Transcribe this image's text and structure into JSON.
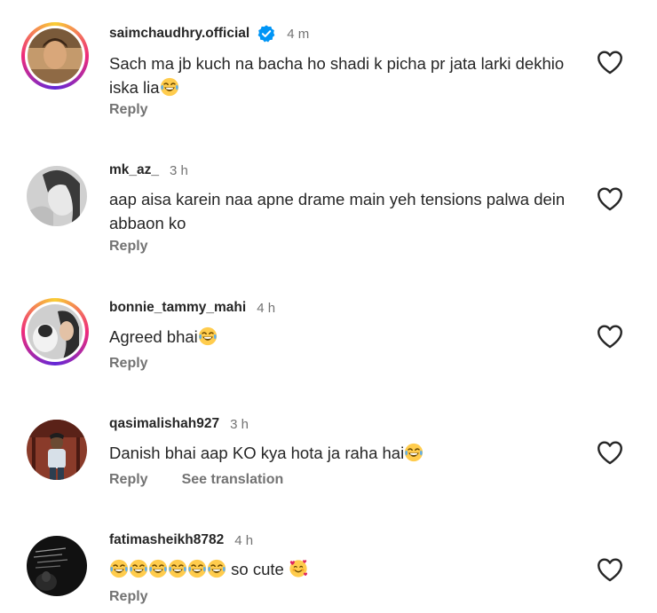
{
  "comments": [
    {
      "username": "saimchaudhry.official",
      "verified": true,
      "time": "4 m",
      "text": "Sach ma jb kuch na bacha ho shadi k picha pr jata larki dekhio iska lia",
      "reply": "Reply"
    },
    {
      "username": "mk_az_",
      "time": "3 h",
      "text": "aap aisa karein naa apne drame main yeh tensions palwa dein abbaon ko",
      "reply": "Reply"
    },
    {
      "username": "bonnie_tammy_mahi",
      "time": "4 h",
      "text": "Agreed bhai",
      "reply": "Reply"
    },
    {
      "username": "qasimalishah927",
      "time": "3 h",
      "text": "Danish bhai aap KO kya hota ja raha hai",
      "reply": "Reply",
      "see_translation": "See translation"
    },
    {
      "username": "fatimasheikh8782",
      "time": "4 h",
      "text": "so cute",
      "reply": "Reply"
    }
  ],
  "icons": {
    "heart": "heart-outline-icon",
    "verified": "verified-badge-icon",
    "laugh_emoji": "face-with-tears-of-joy",
    "hearts_emoji": "smiling-face-with-hearts"
  },
  "colors": {
    "verified_blue": "#0095f6",
    "secondary_text": "#737373"
  }
}
